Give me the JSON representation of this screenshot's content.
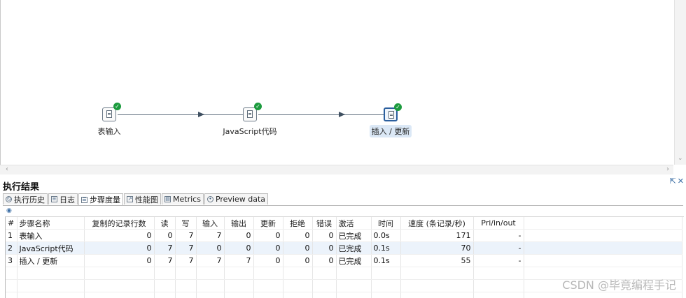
{
  "steps": [
    {
      "label": "表输入",
      "icon": "table-input-icon"
    },
    {
      "label": "JavaScript代码",
      "icon": "javascript-icon"
    },
    {
      "label": "插入 / 更新",
      "icon": "insert-update-icon"
    }
  ],
  "results": {
    "title": "执行结果",
    "window_controls": {
      "maximize": "⇱",
      "close": "✕"
    },
    "tabs": [
      {
        "label": "执行历史",
        "icon": "history-icon"
      },
      {
        "label": "日志",
        "icon": "log-icon"
      },
      {
        "label": "步骤度量",
        "icon": "step-metrics-icon"
      },
      {
        "label": "性能图",
        "icon": "performance-chart-icon"
      },
      {
        "label": "Metrics",
        "icon": "metrics-icon"
      },
      {
        "label": "Preview data",
        "icon": "preview-eye-icon"
      }
    ],
    "columns": [
      "#",
      "步骤名称",
      "复制的记录行数",
      "读",
      "写",
      "输入",
      "输出",
      "更新",
      "拒绝",
      "错误",
      "激活",
      "时间",
      "速度 (条记录/秒)",
      "Pri/in/out"
    ],
    "rows": [
      [
        "1",
        "表输入",
        "0",
        "0",
        "7",
        "7",
        "0",
        "0",
        "0",
        "0",
        "已完成",
        "0.0s",
        "171",
        "-"
      ],
      [
        "2",
        "JavaScript代码",
        "0",
        "7",
        "7",
        "0",
        "0",
        "0",
        "0",
        "0",
        "已完成",
        "0.1s",
        "70",
        "-"
      ],
      [
        "3",
        "插入 / 更新",
        "0",
        "7",
        "7",
        "7",
        "7",
        "0",
        "0",
        "0",
        "已完成",
        "0.1s",
        "55",
        "-"
      ]
    ]
  },
  "watermark": "CSDN @毕竟编程手记"
}
